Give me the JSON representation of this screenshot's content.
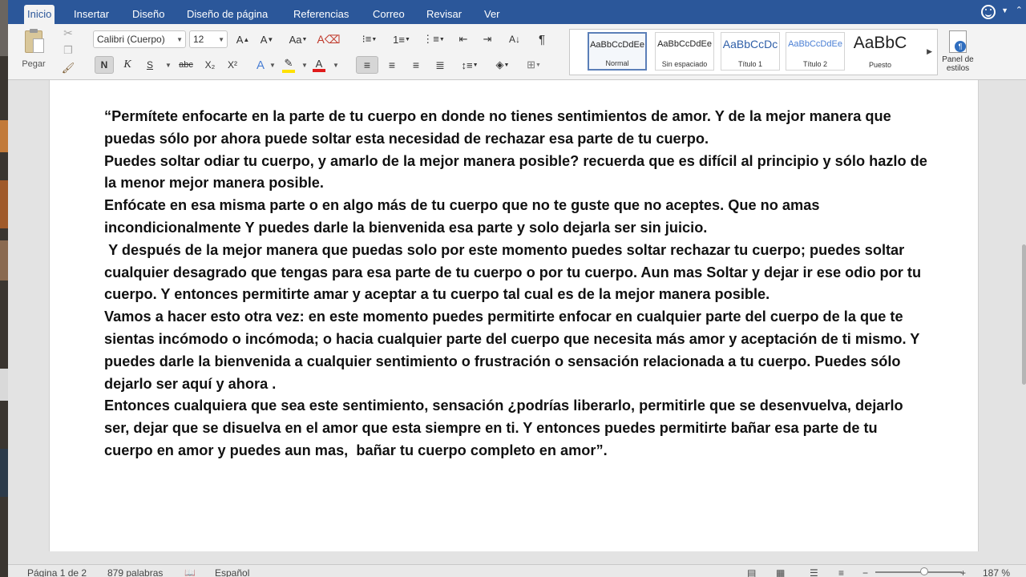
{
  "ribbon_tabs": [
    "Inicio",
    "Insertar",
    "Diseño",
    "Diseño de página",
    "Referencias",
    "Correo",
    "Revisar",
    "Ver"
  ],
  "clipboard": {
    "paste_label": "Pegar"
  },
  "font": {
    "family": "Calibri (Cuerpo)",
    "size": "12"
  },
  "format_buttons": {
    "bold": "N",
    "italic": "K",
    "underline": "S",
    "strike": "abc",
    "subscript": "X₂",
    "superscript": "X²",
    "font_color_letter": "A",
    "highlight": "✎"
  },
  "styles": [
    {
      "preview": "AaBbCcDdEe",
      "name": "Normal"
    },
    {
      "preview": "AaBbCcDdEe",
      "name": "Sin espaciado"
    },
    {
      "preview": "AaBbCcDc",
      "name": "Título 1"
    },
    {
      "preview": "AaBbCcDdEe",
      "name": "Título 2"
    },
    {
      "preview": "AaBbC",
      "name": "Puesto"
    }
  ],
  "panel_label": "Panel de estilos",
  "document": {
    "paragraphs": [
      "“Permítete enfocarte en la parte de tu cuerpo en donde no tienes sentimientos de amor. Y de la mejor manera que puedas sólo por ahora puede soltar esta necesidad de rechazar esa parte de tu cuerpo.",
      "Puedes soltar odiar tu cuerpo, y amarlo de la mejor manera posible? recuerda que es difícil al principio y sólo hazlo de la menor mejor manera posible.",
      "Enfócate en esa misma parte o en algo más de tu cuerpo que no te guste que no aceptes. Que no amas incondicionalmente Y puedes darle la bienvenida esa parte y solo dejarla ser sin juicio.",
      " Y después de la mejor manera que puedas solo por este momento puedes soltar rechazar tu cuerpo; puedes soltar cualquier desagrado que tengas para esa parte de tu cuerpo o por tu cuerpo. Aun mas Soltar y dejar ir ese odio por tu cuerpo. Y entonces permitirte amar y aceptar a tu cuerpo tal cual es de la mejor manera posible.",
      "Vamos a hacer esto otra vez: en este momento puedes permitirte enfocar en cualquier parte del cuerpo de la que te sientas incómodo o incómoda; o hacia cualquier parte del cuerpo que necesita más amor y aceptación de ti mismo. Y puedes darle la bienvenida a cualquier sentimiento o frustración o sensación relacionada a tu cuerpo. Puedes sólo dejarlo ser aquí y ahora .",
      "Entonces cualquiera que sea este sentimiento, sensación ¿podrías liberarlo, permitirle que se desenvuelva, dejarlo ser, dejar que se disuelva en el amor que esta siempre en ti. Y entonces puedes permitirte bañar esa parte de tu cuerpo en amor y puedes aun mas,  bañar tu cuerpo completo en amor”."
    ]
  },
  "status": {
    "page": "Página 1 de 2",
    "words": "879 palabras",
    "language": "Español",
    "zoom": "187 %"
  },
  "colors": {
    "ribbon_blue": "#2b579a",
    "highlight_yellow": "#ffe100",
    "font_red": "#e01b1b"
  }
}
